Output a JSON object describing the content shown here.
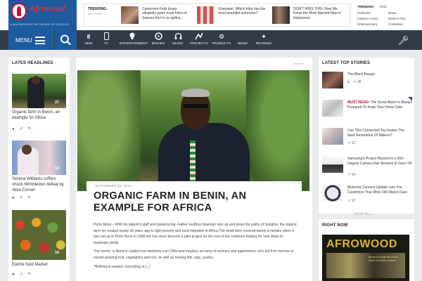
{
  "header": {
    "logo_text": "Afrowood",
    "logo_tagline": "A MAGNIFICENT NETWORK OF CIRCLES",
    "trending_label": "TRENDING",
    "trending_sub": "NEXT READ",
    "trending_items": [
      {
        "text": "Cameroon:Fally Ipupa allegedly posts nude fotos of Samuel Eto'o's ex girlfrie..."
      },
      {
        "text": "Ghanaian: Which tribe has the most beautiful actresses?"
      },
      {
        "text": "DON'T MISS THIS: Now We Know the Most Married Man in Nollywood"
      }
    ],
    "tags_label": "TRENDING",
    "tags": [
      "Hero",
      "Portholes",
      "News",
      "Fashion Focus",
      "Editor's Pick",
      "Entertainment",
      "Celebrities"
    ]
  },
  "nav": {
    "menu_label": "MENU",
    "items": [
      {
        "label": "NEW",
        "number": "8",
        "icon": "new-count-icon"
      },
      {
        "label": "TV",
        "icon": "tv-icon"
      },
      {
        "label": "ENTERTAINMENT",
        "icon": "bulb-icon"
      },
      {
        "label": "MOVIES",
        "icon": "film-icon"
      },
      {
        "label": "MUSIC",
        "icon": "headphones-icon"
      },
      {
        "label": "PROJECTS",
        "icon": "projects-icon"
      },
      {
        "label": "PRODUCTS",
        "icon": "gear-icon"
      },
      {
        "label": "NEWS",
        "icon": "none"
      },
      {
        "label": "REVIEWS",
        "icon": "star-icon"
      }
    ]
  },
  "left": {
    "title": "LATES HEADLINES",
    "cards": [
      {
        "title": "Organic farm in Benin, an example for Africa",
        "count": "27"
      },
      {
        "title": "Serena Williams suffers shock Wimbledon defeat by Alize Cornet",
        "count": "18"
      },
      {
        "title": "Eatrite food Market",
        "count": "18"
      }
    ]
  },
  "main": {
    "dropdown": "more ▾",
    "date": "SEPTEMBER 25, 2015",
    "title": "ORGANIC FARM IN BENIN, AN EXAMPLE FOR AFRICA",
    "p1": "Porto-Novo – With his pilgrim's staff and panama hat, Father Godfrey Nzamujo nips up and down the paths of Songhai, the organic farm he created nearly 30 years ago to fight poverty and rural migration in Africa.The small farm covered barely a hectare when it was set up in Porto Novo in 1985 but has since become a pilot project for the rest of the continent looking for new ideas to maximise yields.",
    "p2": "The centre, in Benin's capital now stretches over 24ha and employs an army of workers and apprentices, who toil from sunrise to sunset growing fruit, vegetables and rice, as well as rearing fish, pigs, poultry.",
    "p3": "\"Nothing is wasted, everything is [...]"
  },
  "right": {
    "title": "LATEST TOP STORIES",
    "stories": [
      {
        "text": "The Black Beauty",
        "meta": "26",
        "prefix": ""
      },
      {
        "text": "The Scout Alarm Is Always Prepared To Keep Your Home Safe",
        "meta": "",
        "prefix": "MUST READ:"
      },
      {
        "text": "Can This Connected Toy Inspire The Next Generation Of Makers?",
        "meta": "12",
        "prefix": ""
      },
      {
        "text": "Samsung's Project Beyond is a 360-Degree Camera that Streams to Gear VR",
        "meta": "14",
        "prefix": ""
      },
      {
        "text": "Motorola Connect Update Lets You Customize Your Moto 360 Watch Face",
        "meta": "12",
        "prefix": ""
      }
    ],
    "view_all": "VIEW ALL →",
    "right_now_title": "RIGHT NOW",
    "ad_word": "AFROWOOD",
    "ad_text": "Afrowood Guide the Future Home of Stories of Africa"
  },
  "colors": {
    "brand_blue": "#1e5a9e",
    "nav_dark": "#333c48",
    "accent_red": "#c8102e"
  }
}
